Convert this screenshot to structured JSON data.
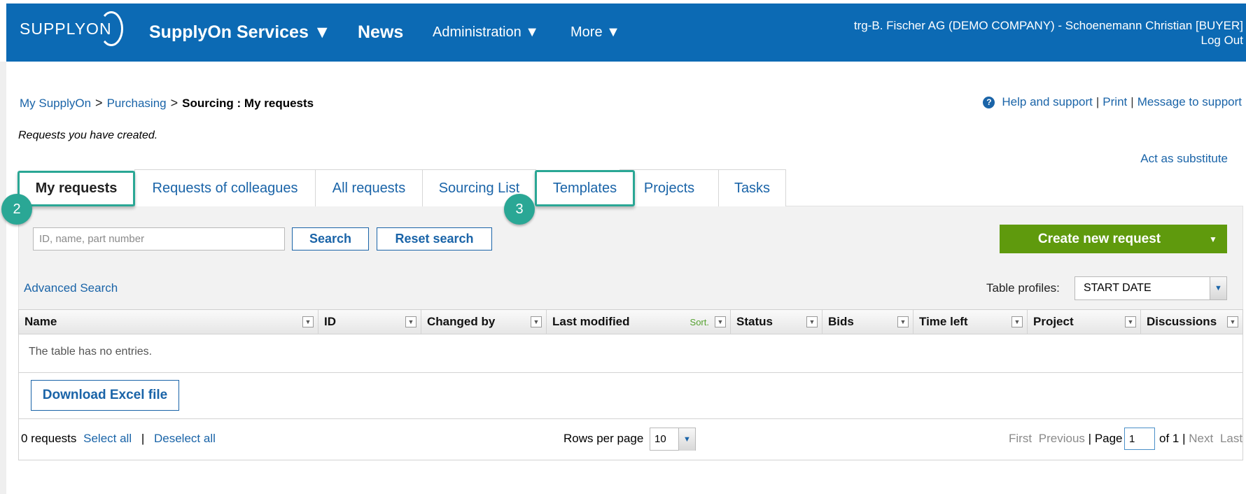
{
  "header": {
    "logo": "SUPPLYON",
    "nav": [
      {
        "label": "SupplyOn Services ▼"
      },
      {
        "label": "News"
      },
      {
        "label": "Administration ▼"
      },
      {
        "label": "More ▼"
      }
    ],
    "user": "trg-B. Fischer AG (DEMO COMPANY) - Schoenemann Christian [BUYER]",
    "logout": "Log Out"
  },
  "breadcrumb": {
    "items": [
      "My SupplyOn",
      "Purchasing"
    ],
    "separator": ">",
    "current": "Sourcing : My requests"
  },
  "help_links": {
    "icon": "question-circle-icon",
    "help": "Help and support",
    "print": "Print",
    "message": "Message to support",
    "pipe": "|"
  },
  "page": {
    "subtitle": "Requests you have created.",
    "substitute": "Act as substitute"
  },
  "tabs": [
    {
      "label": "My requests",
      "active": true
    },
    {
      "label": "Requests of colleagues"
    },
    {
      "label": "All requests"
    },
    {
      "label": "Sourcing List"
    },
    {
      "label": "Templates"
    },
    {
      "label": "Projects"
    },
    {
      "label": "Tasks"
    }
  ],
  "callouts": [
    "2",
    "3"
  ],
  "search": {
    "placeholder": "ID, name, part number",
    "search_label": "Search",
    "reset_label": "Reset search",
    "create_label": "Create new request",
    "create_caret": "▼",
    "advanced": "Advanced Search"
  },
  "profiles": {
    "label": "Table profiles:",
    "value": "START DATE",
    "arrow": "▼"
  },
  "table": {
    "columns": [
      {
        "label": "Name"
      },
      {
        "label": "ID"
      },
      {
        "label": "Changed by"
      },
      {
        "label": "Last modified",
        "sort": "Sort."
      },
      {
        "label": "Status"
      },
      {
        "label": "Bids"
      },
      {
        "label": "Time left"
      },
      {
        "label": "Project"
      },
      {
        "label": "Discussions"
      }
    ],
    "filter_glyph": "▼",
    "empty": "The table has no entries.",
    "download": "Download Excel file"
  },
  "footer": {
    "count": "0 requests",
    "select_all": "Select all",
    "pipe": "|",
    "deselect_all": "Deselect all",
    "rows_label": "Rows per page",
    "rows_value": "10",
    "first": "First",
    "previous": "Previous",
    "page_label": "Page",
    "page_value": "1",
    "of": "of 1",
    "next": "Next",
    "last": "Last"
  },
  "colors": {
    "header_blue": "#0c6ab4",
    "link_blue": "#1a64a8",
    "create_green": "#5f9a0d",
    "callout_teal": "#2aa795"
  }
}
